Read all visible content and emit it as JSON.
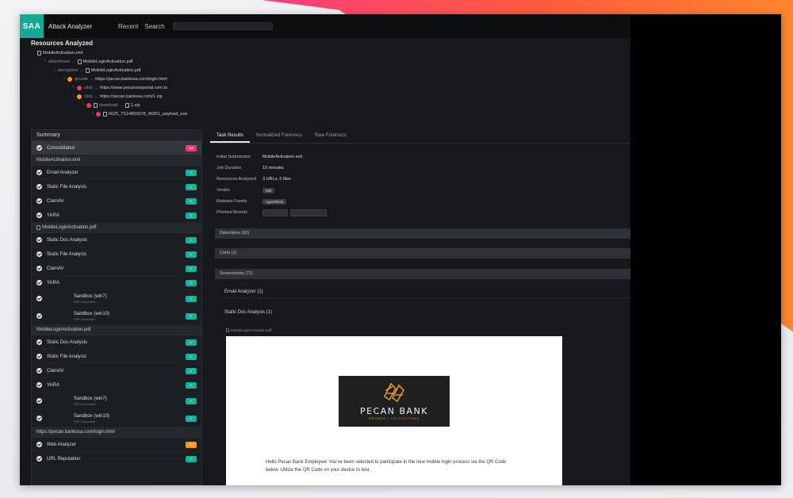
{
  "app": {
    "logo": "SAA",
    "title": "Attack Analyzer"
  },
  "nav": {
    "recent": "Recent",
    "search": "Search"
  },
  "resources": {
    "title": "Resources Analyzed",
    "tree": [
      {
        "rel": "",
        "name": "MobileActivation.eml",
        "icon": "file-icon"
      },
      {
        "rel": "attachment",
        "name": "MobileLoginActivation.pdf",
        "icon": "file-icon"
      },
      {
        "rel": "decryption",
        "name": "MobileLoginActivation.pdf",
        "icon": "file-icon"
      },
      {
        "rel": "qrcode",
        "name": "https://pecan.bankssa.com/login.html",
        "icon": "url-dot"
      },
      {
        "rel": "click",
        "name": "https://www.pecanssoportal.com.to",
        "icon": "url-dot"
      },
      {
        "rel": "click",
        "name": "https://pecan.bankssa.com/1.zip",
        "icon": "url-dot"
      },
      {
        "rel": "download",
        "name": "1.zip",
        "icon": "zip-icon"
      },
      {
        "rel": "",
        "name": "6625_TS14800378_46051_payload_exe",
        "icon": "file-icon"
      }
    ]
  },
  "sidebar": {
    "summary": "Summary",
    "consolidated": {
      "label": "Consolidated",
      "badge": "Mal"
    },
    "groups": [
      {
        "title": "MobileActivation.eml",
        "items": [
          {
            "label": "Email Analyzer",
            "badge": "C"
          },
          {
            "label": "Static File Analysis",
            "badge": "C"
          },
          {
            "label": "ClamAV",
            "badge": "C"
          },
          {
            "label": "YARA",
            "badge": "C"
          }
        ]
      },
      {
        "title": "MobileLoginActivation.pdf",
        "items": [
          {
            "label": "Static Doc Analysis",
            "badge": "C"
          },
          {
            "label": "Static File Analysis",
            "badge": "C"
          },
          {
            "label": "ClamAV",
            "badge": "C"
          },
          {
            "label": "YARA",
            "badge": "C"
          },
          {
            "label": "Sandbox (win7)",
            "sub": "PDF Document",
            "badge": "C"
          },
          {
            "label": "Sandbox (win10)",
            "sub": "PDF Document",
            "badge": "C"
          }
        ]
      },
      {
        "title": "MobileLoginActivation.pdf",
        "items": [
          {
            "label": "Static Doc Analysis",
            "badge": "C"
          },
          {
            "label": "Static File Analysis",
            "badge": "C"
          },
          {
            "label": "ClamAV",
            "badge": "C"
          },
          {
            "label": "YARA",
            "badge": "C"
          },
          {
            "label": "Sandbox (win7)",
            "sub": "PDF Document",
            "badge": "C"
          },
          {
            "label": "Sandbox (win10)",
            "sub": "PDF Document",
            "badge": "C"
          }
        ]
      },
      {
        "title": "https://pecan.bankssa.com/login.html",
        "items": [
          {
            "label": "Web Analyzer",
            "badge": "SU"
          },
          {
            "label": "URL Reputation",
            "badge": "C"
          }
        ]
      }
    ]
  },
  "main": {
    "tabs": [
      "Task Results",
      "Normalized Forensics",
      "Raw Forensics"
    ],
    "details": {
      "initial_submission": {
        "label": "Initial Submission",
        "value": "MobileActivation.eml"
      },
      "job_duration": {
        "label": "Job Duration",
        "value": "10 minutes"
      },
      "resources_analyzed": {
        "label": "Resources Analyzed",
        "value": "3 URLs, 5 files"
      },
      "verdict": {
        "label": "Verdict",
        "value": "Mal"
      },
      "malware_family": {
        "label": "Malware Family",
        "value": "AgentTesla"
      },
      "phished_brands": {
        "label": "Phished Brands"
      }
    },
    "sections": {
      "detections": "Detections (62)",
      "certs": "Certs (1)",
      "screenshots": "Screenshots (71)",
      "email_analyzer": "Email Analyzer (1)",
      "static_doc": "Static Doc Analysis (1)",
      "file_label": "MobileLoginActivation.pdf"
    },
    "preview": {
      "bank_name": "PECAN BANK",
      "bank_tagline": "GROWTH • COLLECTIONS",
      "text": "Hello Pecan Bank Employee! You've been selected to participate in the new mobile login process via the QR Code below. Utilize the QR Code on your device to test."
    }
  },
  "colors": {
    "accent": "#16a795",
    "malicious": "#f0346e",
    "suspicious": "#f5961f",
    "clean": "#16b39c"
  }
}
